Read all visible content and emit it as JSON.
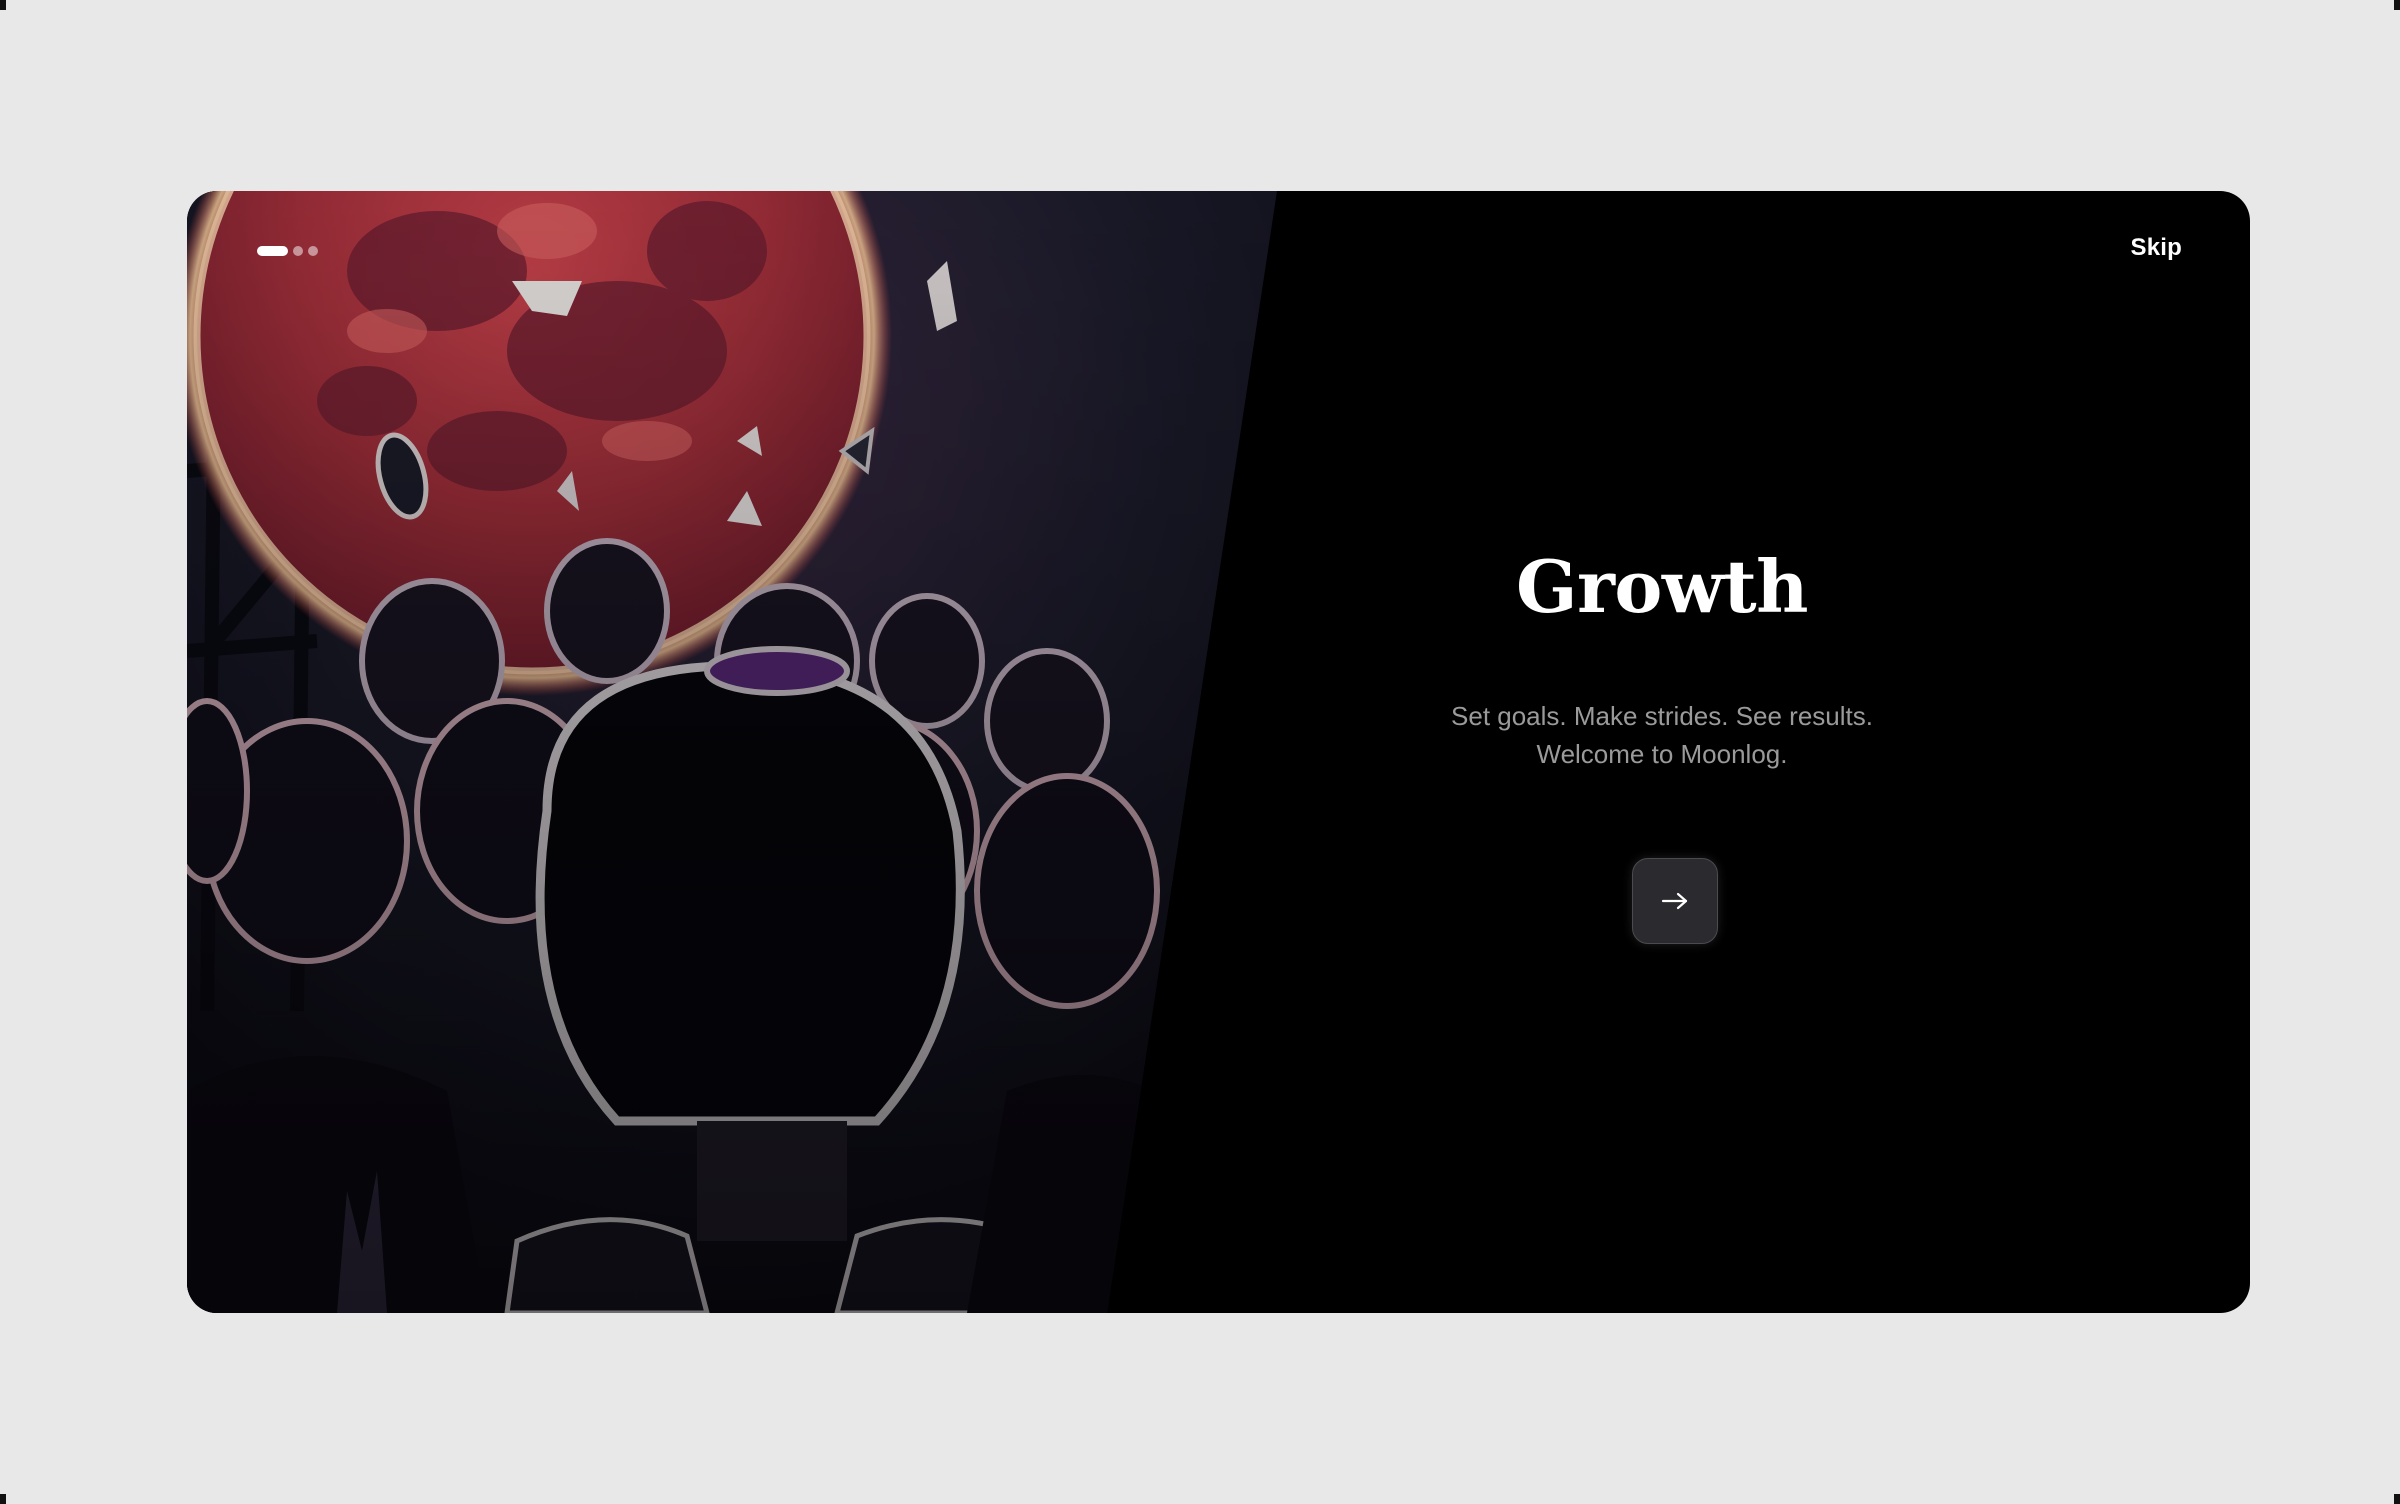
{
  "onboarding": {
    "step_indicator": {
      "total_steps": 3,
      "current_step": 1
    },
    "skip_label": "Skip",
    "title": "Growth",
    "subtitle_line1": "Set goals. Make strides. See results.",
    "subtitle_line2": "Welcome to Moonlog.",
    "next_button_icon": "arrow-right-icon"
  },
  "colors": {
    "page_background": "#e8e8e8",
    "card_background": "#000000",
    "title_text": "#ffffff",
    "subtitle_text": "#9a9a9a",
    "button_background": "#2b2b2f",
    "moon_red": "#c2404a"
  }
}
